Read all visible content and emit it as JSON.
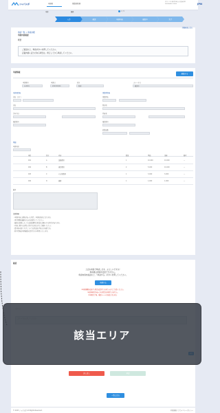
{
  "header": {
    "logo": "ジャパスポ",
    "tabs": [
      "申請者",
      "事業者管理"
    ],
    "subtabs": [
      "申請",
      "履歴"
    ],
    "user_info": "ログイン中 株式会社○○ 担当者 様",
    "user_info2": "2023/04/01 10:00",
    "corner_label": "JPN"
  },
  "stepper": {
    "steps": [
      "入力",
      "確認",
      "申請内容",
      "審査中",
      "完了"
    ],
    "page_indicator": "1 / 5"
  },
  "top_card": {
    "breadcrumb": "申請一覧 > 申請詳細",
    "title": "申請内容確認",
    "subtitle": "概要",
    "note_line1": "ご確認の上、申請ボタンを押してください。",
    "note_line2": "記載内容に誤りがある場合は、修正してから申請してください。",
    "right_link": "詳細画面に戻る"
  },
  "form": {
    "section_title": "申請情報",
    "action_button": "編集する",
    "labels_row1": [
      "申請番号",
      "申請日",
      "区分",
      "ステータス"
    ],
    "values_row1": [
      "A-0001",
      "2023/04/01",
      "新規",
      "確認中"
    ],
    "left_block_title": "申請者情報",
    "right_block_title": "事業所情報",
    "left_labels": [
      "氏名（カナ）",
      "氏名",
      "生年月日",
      "電話番号",
      "住所"
    ],
    "right_labels": [
      "事業所名",
      "所在地",
      "代表者",
      "電話番号",
      "従業員数"
    ],
    "table_title": "明細",
    "table_subtitle": "申請内訳",
    "table_headers": [
      "項目",
      "区分",
      "内容",
      "数量",
      "単価",
      "金額",
      "備考"
    ],
    "table_rows": [
      [
        "001",
        "A",
        "設備費用",
        "1",
        "10,000",
        "10,000",
        "—"
      ],
      [
        "002",
        "B",
        "運営費用",
        "2",
        "5,000",
        "10,000",
        "—"
      ],
      [
        "003",
        "C",
        "その他費用",
        "1",
        "3,000",
        "3,000",
        "—"
      ],
      [
        "004",
        "D",
        "雑費",
        "1",
        "1,000",
        "1,000",
        "—"
      ]
    ],
    "remarks_label": "備考",
    "notes_title": "注意事項",
    "notes": [
      "・申請内容に虚偽があった場合、申請は無効となります。",
      "・添付書類は最新のものを使用してください。",
      "・審査の結果によっては追加資料の提出をお願いする場合があります。",
      "・内容に関するお問い合わせは窓口までご連絡ください。",
      "・受付後の取り下げについては別途お手続きが必要です。",
      "・個人情報は申請審査の目的でのみ利用いたします。"
    ]
  },
  "bottom": {
    "section_title": "確認",
    "message1": "上記の内容で申請します。よろしいですか？",
    "message2": "申請後は内容を変更できません。",
    "message3": "申請内容を確認の上、「申請する」ボタンを押してください。",
    "primary_button": "申請する",
    "warning_text": [
      "※申請期限を過ぎた場合は受付できませんのでご注意ください。",
      "※必須項目が未入力の場合は申請できません。",
      "※申請完了後、確認メールが送信されます。"
    ],
    "comment_label": "コメント",
    "comment_placeholder": "コメントを入力してください",
    "submit_small": "送信",
    "red_button": "差し戻し",
    "green_button": "承認",
    "back_button": "一覧に戻る"
  },
  "overlay": {
    "caption": "該当エリア"
  },
  "footer": {
    "left": "© 2023 ジャパスポ All Rights Reserved.",
    "right": "利用規約 / プライバシーポリシー"
  },
  "colors": {
    "accent": "#2f8fe0",
    "step_active": "#2c8ae0",
    "step_inactive": "#7fb8ec",
    "danger": "#ef5a4c",
    "success": "#cfe8df"
  }
}
